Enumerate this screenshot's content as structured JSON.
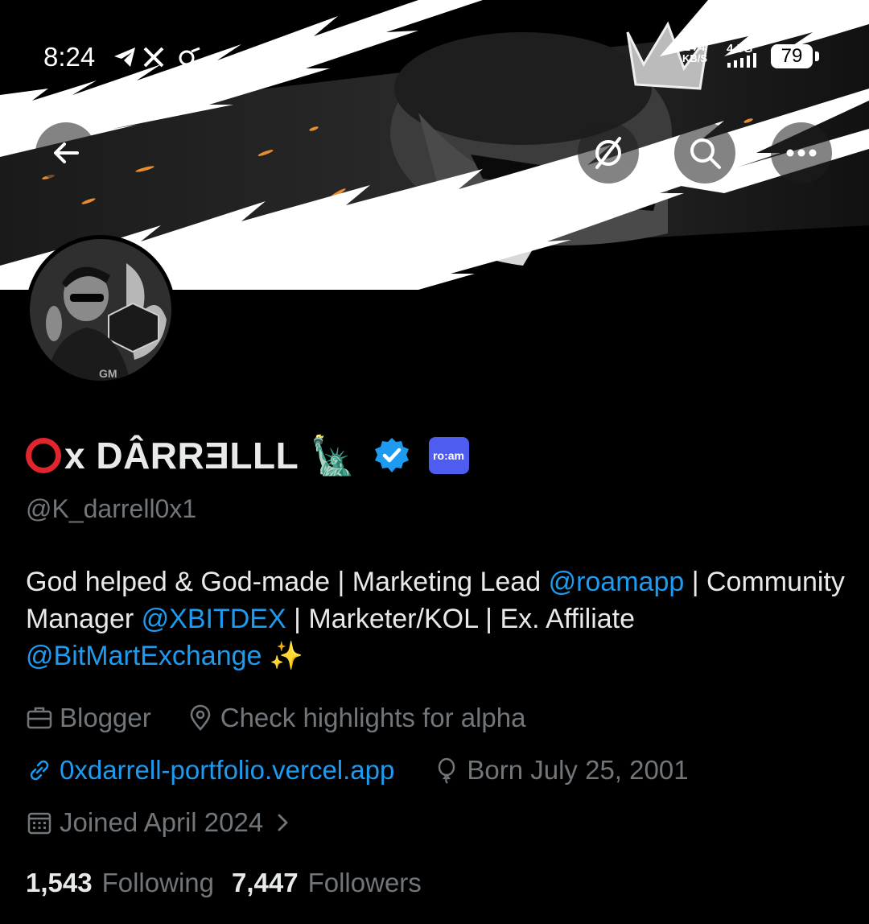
{
  "status_bar": {
    "time": "8:24",
    "net_speed_top": "14.4",
    "net_speed_unit": "KB/S",
    "network_type": "4.5G",
    "battery": "79",
    "icons": [
      "telegram-icon",
      "x-icon",
      "link-icon"
    ]
  },
  "nav": {
    "back_icon": "arrow-left-icon",
    "grok_icon": "grok-icon",
    "search_icon": "search-icon",
    "more_icon": "more-icon"
  },
  "profile": {
    "display_name": "x DÂRRƎLLL",
    "name_emoji": "🗽",
    "affiliate_label": "ro:am",
    "handle": "@K_darrell0x1",
    "bio": {
      "p1": "God helped & God-made | Marketing Lead ",
      "m1": "@roamapp",
      "p2": " | Community Manager ",
      "m2": "@XBITDEX",
      "p3": " | Marketer/KOL | Ex. Affiliate ",
      "m3": "@BitMartExchange",
      "p4": " ✨"
    },
    "profession": "Blogger",
    "location": "Check highlights for alpha",
    "website": "0xdarrell-portfolio.vercel.app",
    "birthday": "Born July 25, 2001",
    "joined": "Joined April 2024",
    "following_count": "1,543",
    "following_label": "Following",
    "followers_count": "7,447",
    "followers_label": "Followers"
  },
  "colors": {
    "accent": "#1d9bf0",
    "muted": "#71767b",
    "text": "#e7e9ea",
    "affiliate": "#4f5cf0",
    "name_circle": "#e0252f"
  }
}
